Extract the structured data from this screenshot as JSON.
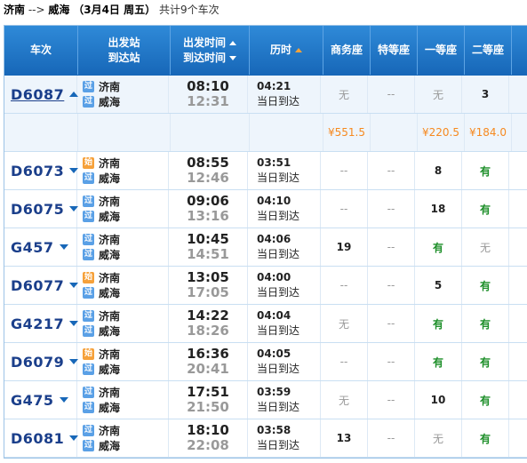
{
  "header_line": {
    "from": "济南",
    "arrow": "-->",
    "to": "威海",
    "date": "（3月4日  周五）",
    "count": "共计9个车次"
  },
  "columns": {
    "train": "车次",
    "station_1": "出发站",
    "station_2": "到达站",
    "time_1": "出发时间",
    "time_2": "到达时间",
    "duration": "历时",
    "business": "商务座",
    "special": "特等座",
    "first": "一等座",
    "second": "二等座"
  },
  "badges": {
    "pass": "过",
    "start": "始"
  },
  "trains": [
    {
      "no": "D6087",
      "from_type": "pass",
      "from": "济南",
      "to": "威海",
      "dep": "08:10",
      "arr": "12:31",
      "dur": "04:21",
      "day": "当日到达",
      "business": "无",
      "special": "--",
      "first": "无",
      "second": "3",
      "prices": [
        "¥551.5",
        "",
        "¥220.5",
        "¥184.0"
      ]
    },
    {
      "no": "D6073",
      "from_type": "start",
      "from": "济南",
      "to": "威海",
      "dep": "08:55",
      "arr": "12:46",
      "dur": "03:51",
      "day": "当日到达",
      "business": "--",
      "special": "--",
      "first": "8",
      "second": "有"
    },
    {
      "no": "D6075",
      "from_type": "pass",
      "from": "济南",
      "to": "威海",
      "dep": "09:06",
      "arr": "13:16",
      "dur": "04:10",
      "day": "当日到达",
      "business": "--",
      "special": "--",
      "first": "18",
      "second": "有"
    },
    {
      "no": "G457",
      "from_type": "pass",
      "from": "济南",
      "to": "威海",
      "dep": "10:45",
      "arr": "14:51",
      "dur": "04:06",
      "day": "当日到达",
      "business": "19",
      "special": "--",
      "first": "有",
      "second": "无"
    },
    {
      "no": "D6077",
      "from_type": "start",
      "from": "济南",
      "to": "威海",
      "dep": "13:05",
      "arr": "17:05",
      "dur": "04:00",
      "day": "当日到达",
      "business": "--",
      "special": "--",
      "first": "5",
      "second": "有"
    },
    {
      "no": "G4217",
      "from_type": "pass",
      "from": "济南",
      "to": "威海",
      "dep": "14:22",
      "arr": "18:26",
      "dur": "04:04",
      "day": "当日到达",
      "business": "无",
      "special": "--",
      "first": "有",
      "second": "有"
    },
    {
      "no": "D6079",
      "from_type": "start",
      "from": "济南",
      "to": "威海",
      "dep": "16:36",
      "arr": "20:41",
      "dur": "04:05",
      "day": "当日到达",
      "business": "--",
      "special": "--",
      "first": "有",
      "second": "有"
    },
    {
      "no": "G475",
      "from_type": "pass",
      "from": "济南",
      "to": "威海",
      "dep": "17:51",
      "arr": "21:50",
      "dur": "03:59",
      "day": "当日到达",
      "business": "无",
      "special": "--",
      "first": "10",
      "second": "有"
    },
    {
      "no": "D6081",
      "from_type": "pass",
      "from": "济南",
      "to": "威海",
      "dep": "18:10",
      "arr": "22:08",
      "dur": "03:58",
      "day": "当日到达",
      "business": "13",
      "special": "--",
      "first": "无",
      "second": "有"
    }
  ]
}
